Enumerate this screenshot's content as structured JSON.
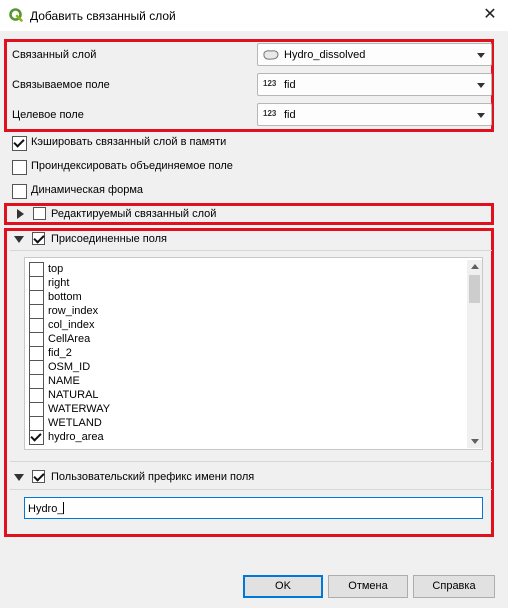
{
  "window": {
    "title": "Добавить связанный слой",
    "app_icon": "qgis-logo-icon",
    "close_glyph": "✕"
  },
  "join_settings": {
    "join_layer": {
      "label": "Связанный слой",
      "value": "Hydro_dissolved",
      "icon": "polygon-layer-icon"
    },
    "join_field": {
      "label": "Связываемое поле",
      "value": "fid",
      "icon": "numeric-field-icon",
      "icon_text": "123"
    },
    "target_field": {
      "label": "Целевое поле",
      "value": "fid",
      "icon": "numeric-field-icon",
      "icon_text": "123"
    }
  },
  "options": {
    "cache_join": {
      "label": "Кэшировать связанный слой в памяти",
      "checked": true
    },
    "create_index": {
      "label": "Проиндексировать объединяемое поле",
      "checked": false
    },
    "dynamic_form": {
      "label": "Динамическая форма",
      "checked": false
    }
  },
  "editable_group": {
    "label": "Редактируемый связанный слой",
    "checked": false,
    "expanded": false
  },
  "joined_fields_group": {
    "label": "Присоединенные поля",
    "checked": true,
    "expanded": true,
    "fields": [
      {
        "name": "top",
        "checked": false
      },
      {
        "name": "right",
        "checked": false
      },
      {
        "name": "bottom",
        "checked": false
      },
      {
        "name": "row_index",
        "checked": false
      },
      {
        "name": "col_index",
        "checked": false
      },
      {
        "name": "CellArea",
        "checked": false
      },
      {
        "name": "fid_2",
        "checked": false
      },
      {
        "name": "OSM_ID",
        "checked": false
      },
      {
        "name": "NAME",
        "checked": false
      },
      {
        "name": "NATURAL",
        "checked": false
      },
      {
        "name": "WATERWAY",
        "checked": false
      },
      {
        "name": "WETLAND",
        "checked": false
      },
      {
        "name": "hydro_area",
        "checked": true
      }
    ]
  },
  "prefix_group": {
    "label": "Пользовательский префикс имени поля",
    "checked": true,
    "expanded": true,
    "value": "Hydro_"
  },
  "buttons": {
    "ok": "OK",
    "cancel": "Отмена",
    "help": "Справка"
  },
  "colors": {
    "highlight": "#e0101f",
    "focus": "#0078d7",
    "dialog_bg": "#f0f0f0"
  }
}
